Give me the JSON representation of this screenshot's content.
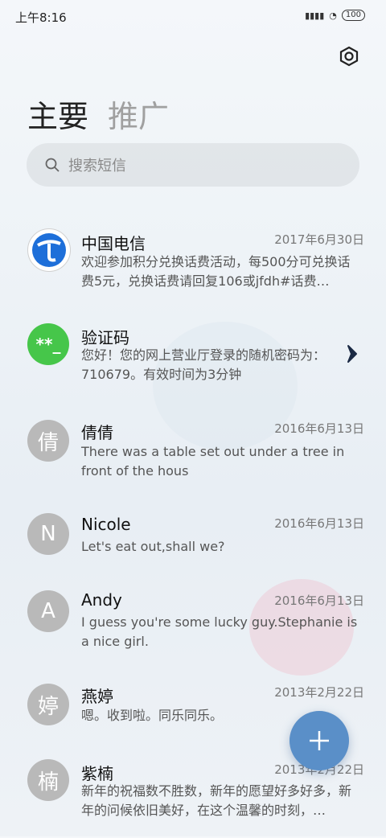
{
  "status_bar": {
    "time": "上午8:16",
    "battery": "100"
  },
  "tabs": {
    "main": "主要",
    "promo": "推广"
  },
  "search": {
    "placeholder": "搜索短信"
  },
  "messages": [
    {
      "name": "中国电信",
      "date": "2017年6月30日",
      "preview": "欢迎参加积分兑换话费活动，每500分可兑换话费5元，兑换话费请回复106或jfdh#话费…",
      "avatar": ""
    },
    {
      "name": "验证码",
      "date": "",
      "preview": "您好！您的网上营业厅登录的随机密码为：710679。有效时间为3分钟",
      "avatar": "**_"
    },
    {
      "name": "倩倩",
      "date": "2016年6月13日",
      "preview": "There was a table set out under a tree in front of the hous",
      "avatar": "倩"
    },
    {
      "name": "Nicole",
      "date": "2016年6月13日",
      "preview": "Let's eat out,shall we?",
      "avatar": "N"
    },
    {
      "name": "Andy",
      "date": "2016年6月13日",
      "preview": "I guess you're some lucky guy.Stephanie is a nice girl.",
      "avatar": "A"
    },
    {
      "name": "燕婷",
      "date": "2013年2月22日",
      "preview": "嗯。收到啦。同乐同乐。",
      "avatar": "婷"
    },
    {
      "name": "紫楠",
      "date": "2013年2月22日",
      "preview": "新年的祝福数不胜数，新年的愿望好多好多，新年的问候依旧美好，在这个温馨的时刻，…",
      "avatar": "楠"
    }
  ],
  "colors": {
    "fab": "#5a8fc8",
    "verify_avatar": "#46c64a",
    "telecom_blue": "#1e6fd9"
  }
}
